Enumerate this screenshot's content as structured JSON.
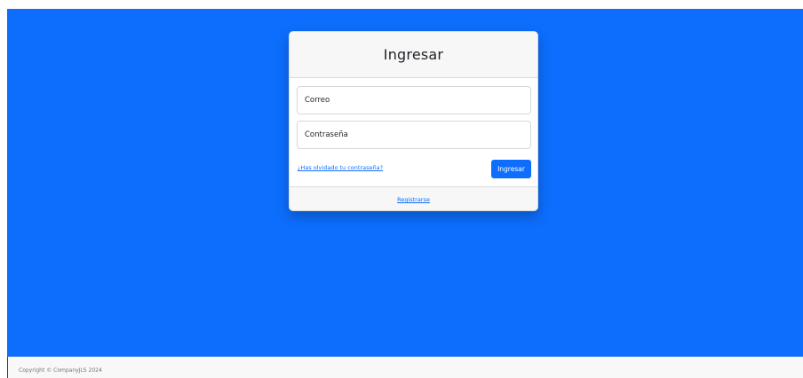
{
  "login": {
    "title": "Ingresar",
    "email_placeholder": "Correo",
    "password_placeholder": "Contraseña",
    "forgot_password": "¿Has olvidado tu contraseña?",
    "submit_label": "Ingresar",
    "register_link": "Registrarse"
  },
  "footer": {
    "copyright": "Copyright © CompanyJLS 2024"
  },
  "colors": {
    "background": "#0d6efd",
    "primary": "#0d6efd",
    "card_header": "#f7f7f7"
  }
}
